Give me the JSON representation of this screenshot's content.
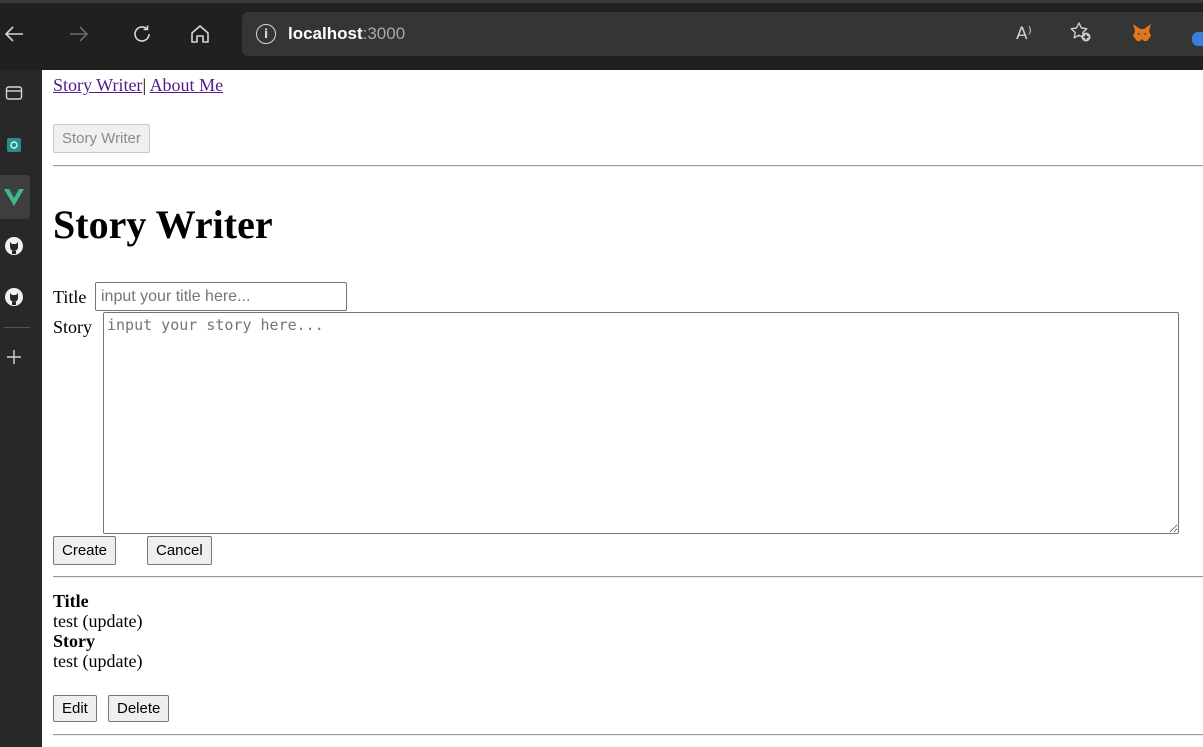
{
  "browser": {
    "url_host": "localhost",
    "url_port": ":3000",
    "read_aloud_label": "A⁾"
  },
  "nav": {
    "story_writer_link": "Story Writer",
    "separator": "|",
    "about_link": "About Me"
  },
  "top_button": {
    "label": "Story Writer"
  },
  "heading": "Story Writer",
  "form": {
    "title_label": "Title",
    "title_placeholder": "input your title here...",
    "story_label": "Story",
    "story_placeholder": "input your story here...",
    "create_label": "Create",
    "cancel_label": "Cancel"
  },
  "entries": [
    {
      "title_heading": "Title",
      "title_value": "test (update)",
      "story_heading": "Story",
      "story_value": "test (update)",
      "edit_label": "Edit",
      "delete_label": "Delete"
    }
  ],
  "colors": {
    "chrome_bg": "#202020",
    "address_bg": "#353535",
    "sidebar_bg": "#282828",
    "link_visited": "#551a8b",
    "vue_green": "#42b883",
    "metamask_orange": "#e2761b"
  }
}
